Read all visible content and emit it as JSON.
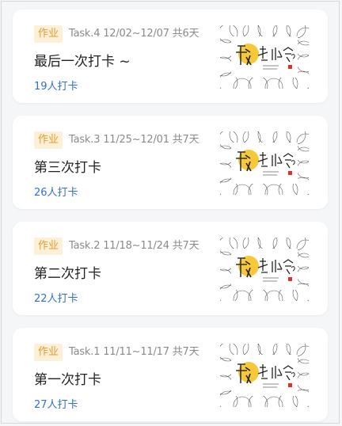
{
  "tasks": [
    {
      "tag": "作业",
      "meta": "Task.4 12/02~12/07 共6天",
      "title": "最后一次打卡 ~",
      "count": "19人打卡",
      "thumbnail": {
        "logo_text": "讀者协会",
        "subtext": "Du Zhe Xie Hui"
      }
    },
    {
      "tag": "作业",
      "meta": "Task.3 11/25~12/01 共7天",
      "title": "第三次打卡",
      "count": "26人打卡",
      "thumbnail": {
        "logo_text": "讀者协会",
        "subtext": "Du Zhe Xie Hui"
      }
    },
    {
      "tag": "作业",
      "meta": "Task.2 11/18~11/24 共7天",
      "title": "第二次打卡",
      "count": "22人打卡",
      "thumbnail": {
        "logo_text": "讀者协会",
        "subtext": "Du Zhe Xie Hui"
      }
    },
    {
      "tag": "作业",
      "meta": "Task.1 11/11~11/17 共7天",
      "title": "第一次打卡",
      "count": "27人打卡",
      "thumbnail": {
        "logo_text": "讀者协会",
        "subtext": "Du Zhe Xie Hui"
      }
    }
  ],
  "colors": {
    "tag_bg": "#fdf0d9",
    "tag_text": "#e89a2c",
    "count_text": "#2f6fd6",
    "logo_yellow": "#f7c83a"
  }
}
